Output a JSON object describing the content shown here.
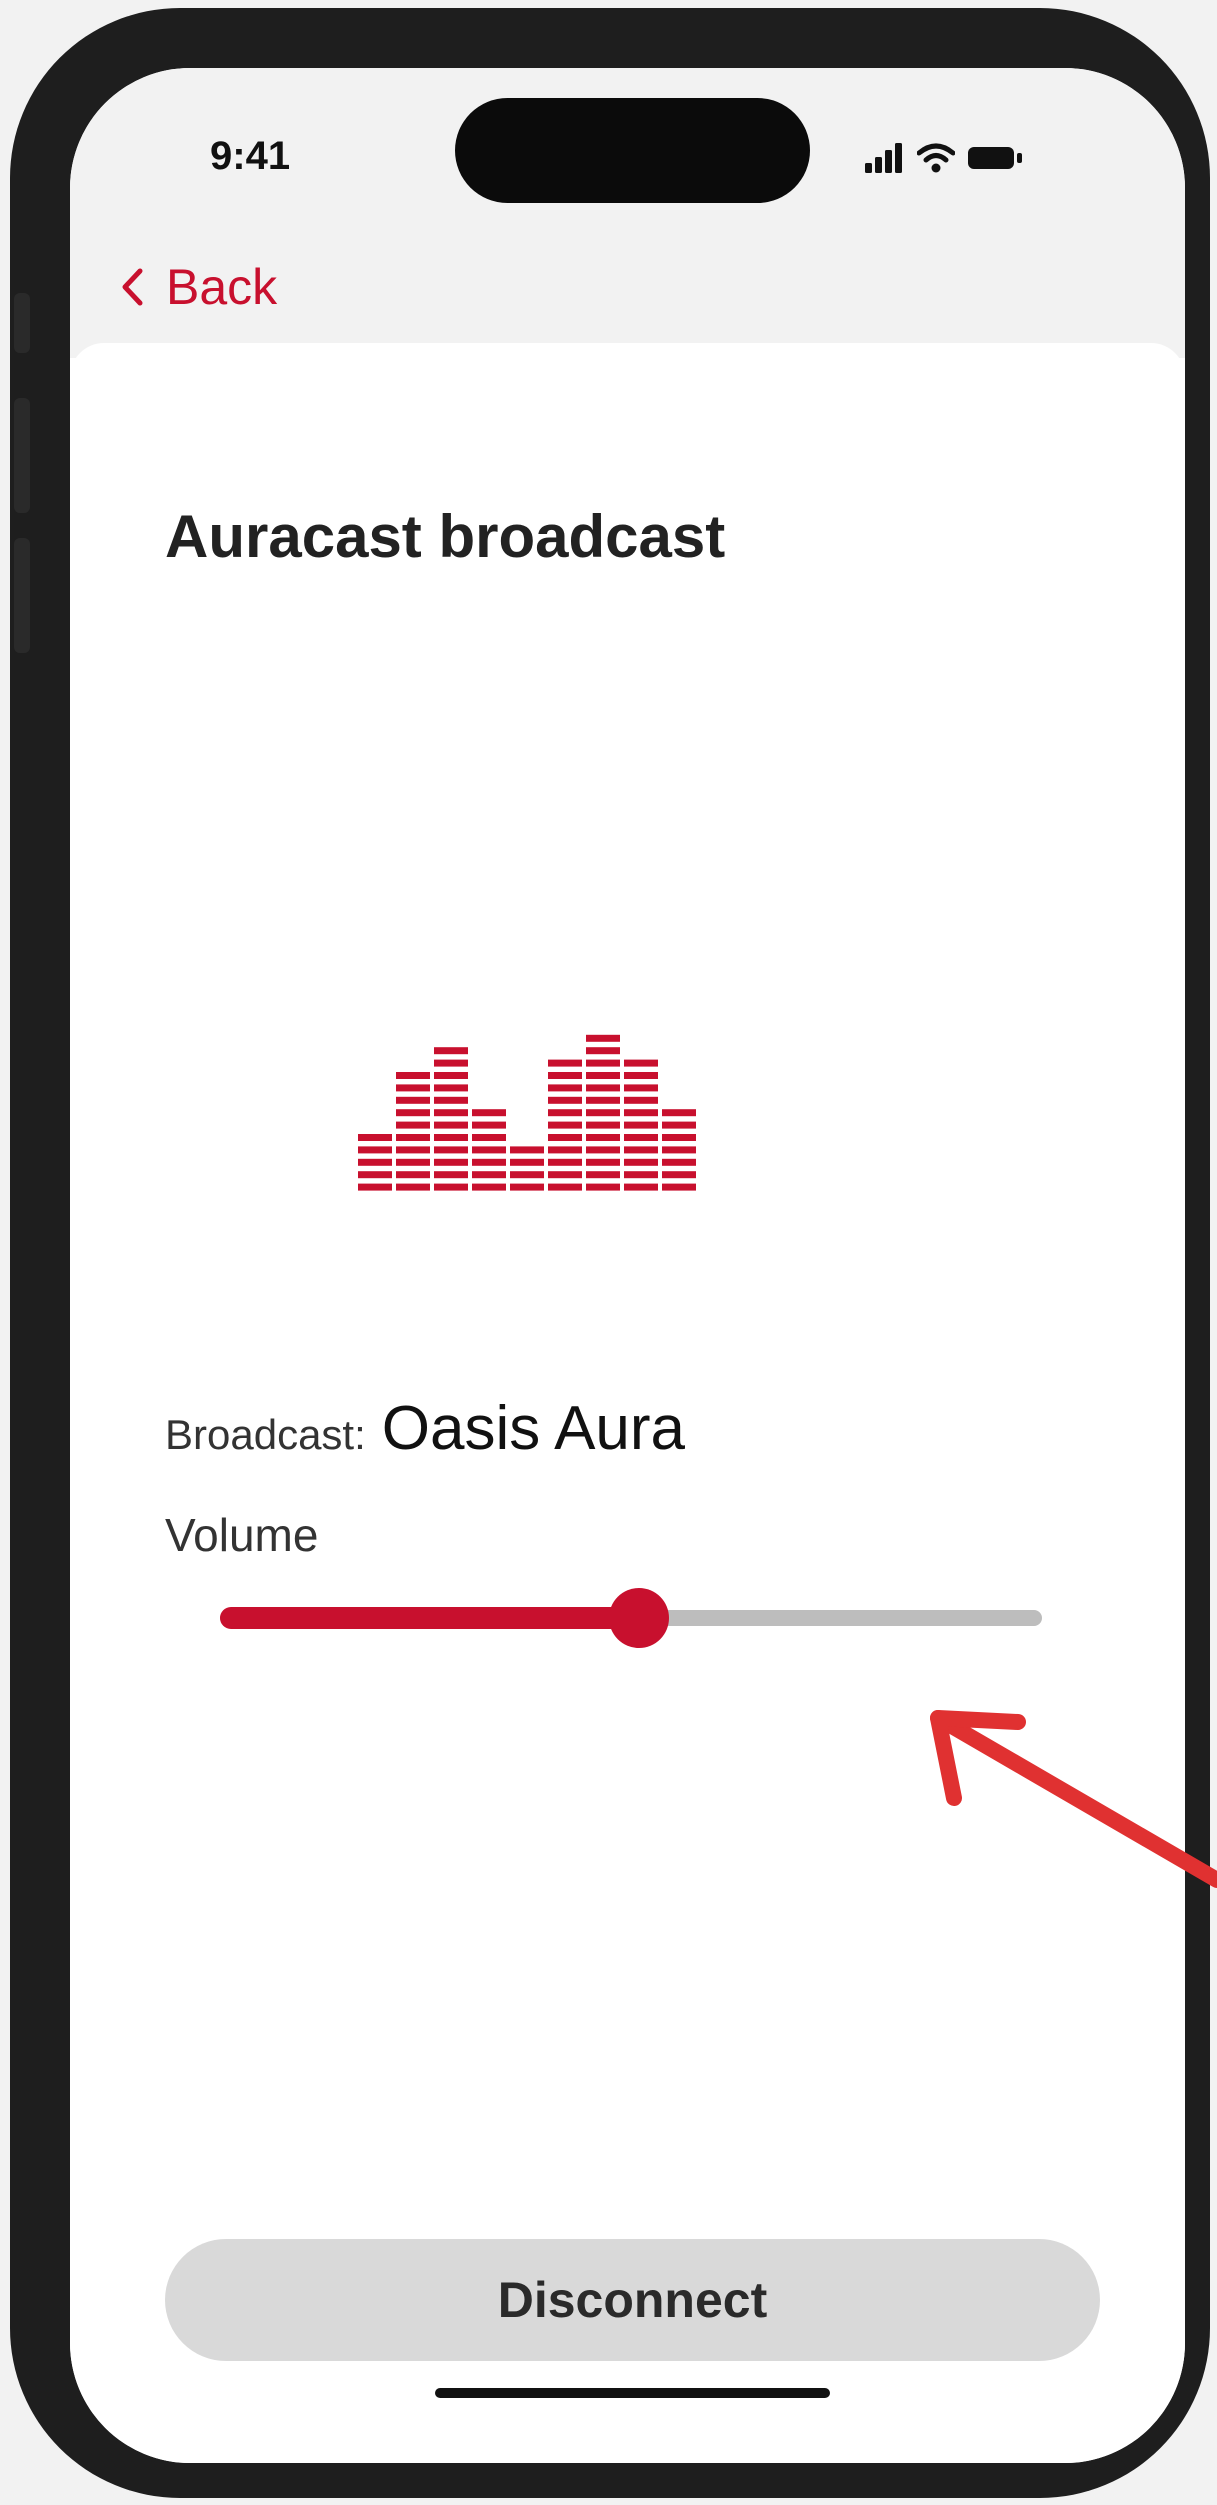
{
  "status_bar": {
    "time": "9:41"
  },
  "nav": {
    "back_label": "Back"
  },
  "page": {
    "title": "Auracast broadcast"
  },
  "broadcast": {
    "label": "Broadcast:",
    "name": "Oasis Aura"
  },
  "volume": {
    "label": "Volume",
    "level": 0.51
  },
  "actions": {
    "disconnect_label": "Disconnect"
  },
  "equalizer": {
    "levels": [
      5,
      10,
      12,
      7,
      4,
      11,
      13,
      11,
      7
    ]
  },
  "colors": {
    "accent": "#c8102e",
    "track": "#bdbdbd",
    "button_bg": "#d9d9d9",
    "annotation_arrow": "#e03131"
  },
  "icons": [
    "chevron-left-icon",
    "signal-icon",
    "wifi-icon",
    "battery-icon",
    "equalizer-icon",
    "arrow-annotation-icon"
  ]
}
